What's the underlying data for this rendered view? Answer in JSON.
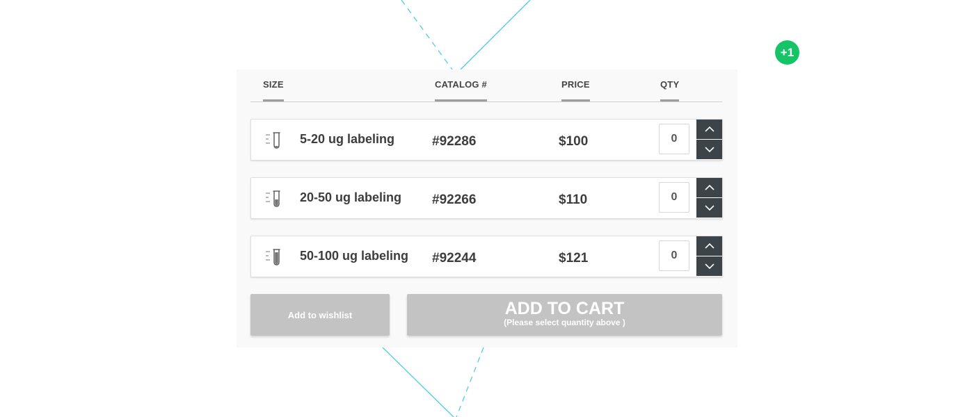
{
  "badge": {
    "text": "+1"
  },
  "header": {
    "size": "SIZE",
    "catalog": "CATALOG #",
    "price": "PRICE",
    "qty": "QTY"
  },
  "products": [
    {
      "size": "5-20 ug labeling",
      "catalog": "#92286",
      "price": "$100",
      "qty": "0"
    },
    {
      "size": "20-50 ug labeling",
      "catalog": "#92266",
      "price": "$110",
      "qty": "0"
    },
    {
      "size": "50-100 ug labeling",
      "catalog": "#92244",
      "price": "$121",
      "qty": "0"
    }
  ],
  "actions": {
    "wishlist_label": "Add to wishlist",
    "cart_label": "ADD TO CART",
    "cart_hint": "(Please select quantity above )"
  },
  "colors": {
    "accent_line": "#4ecfdc",
    "badge_bg": "#14c467",
    "stepper_bg": "#3c4349",
    "disabled_button": "#c3c3c3"
  },
  "icons": {
    "tube": "test-tube-icon",
    "up": "chevron-up-icon",
    "down": "chevron-down-icon"
  }
}
